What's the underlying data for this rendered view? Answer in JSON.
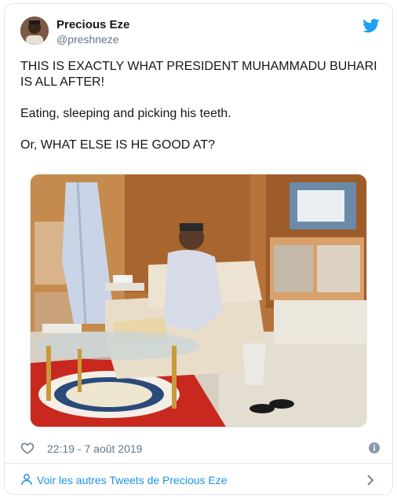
{
  "tweet": {
    "author_name": "Precious Eze",
    "author_handle": "@preshneze",
    "text_lines": [
      "THIS IS EXACTLY WHAT PRESIDENT MUHAMMADU BUHARI IS ALL AFTER!",
      "Eating, sleeping and picking his teeth.",
      "Or, WHAT ELSE IS HE GOOD AT?"
    ],
    "timestamp": "22:19 - 7 août 2019"
  },
  "footer": {
    "link_text": "Voir les autres Tweets de Precious Eze"
  },
  "icons": {
    "brand": "twitter-bird-icon",
    "like": "heart-icon",
    "info": "info-icon",
    "profile": "person-icon",
    "more": "chevron-right-icon"
  },
  "colors": {
    "brand_blue": "#1da1f2",
    "link_blue": "#1b95e0",
    "muted_gray": "#657786",
    "border": "#e1e8ed"
  }
}
